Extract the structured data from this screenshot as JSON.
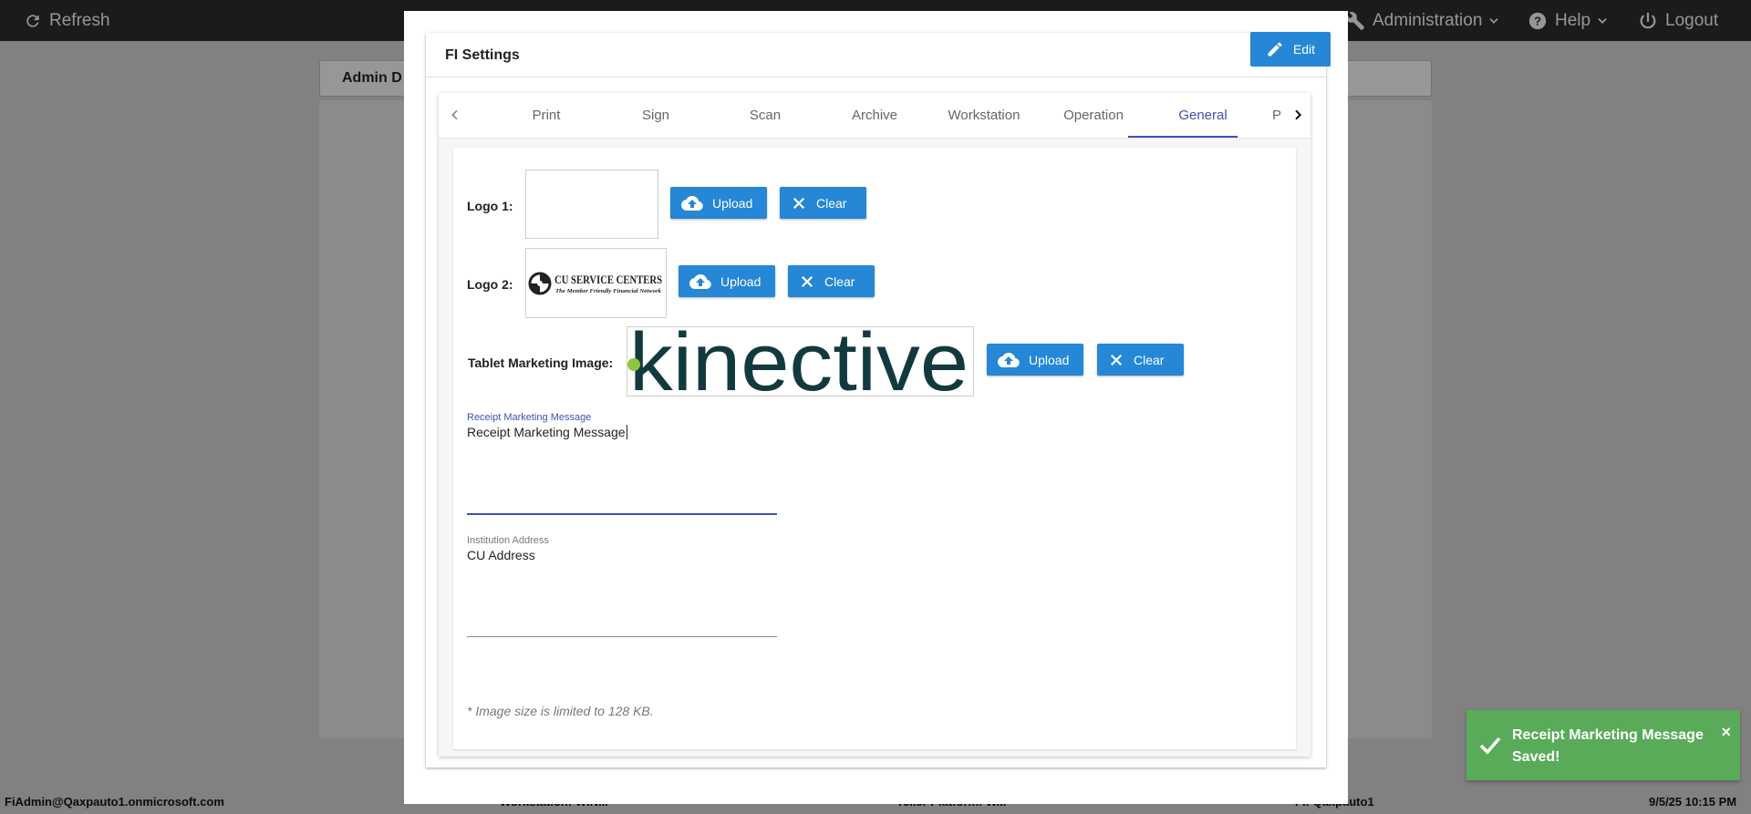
{
  "topbar": {
    "refresh_label": "Refresh",
    "administration_label": "Administration",
    "help_label": "Help",
    "logout_label": "Logout"
  },
  "background": {
    "admin_header": "Admin D"
  },
  "statusbar": {
    "user": "FiAdmin@Qaxpauto1.onmicrosoft.com",
    "workstation": "Workstation: WIN...",
    "platform": "Teller Platform: W...",
    "fi": "FI: Qaxpauto1",
    "datetime": "9/5/25 10:15 PM"
  },
  "modal": {
    "title": "FI Settings",
    "edit_label": "Edit",
    "tabs": [
      {
        "label": "Print"
      },
      {
        "label": "Sign"
      },
      {
        "label": "Scan"
      },
      {
        "label": "Archive"
      },
      {
        "label": "Workstation"
      },
      {
        "label": "Operation"
      },
      {
        "label": "General"
      },
      {
        "label": "P"
      }
    ],
    "active_tab": "General",
    "general": {
      "logo1_label": "Logo 1:",
      "logo2_label": "Logo 2:",
      "tablet_label": "Tablet Marketing Image:",
      "upload_label": "Upload",
      "clear_label": "Clear",
      "logo2_text_main": "CU SERVICE CENTERS",
      "logo2_text_sub": "The Member Friendly Financial Network",
      "tablet_image_text": "kinective",
      "receipt_field_label": "Receipt Marketing Message",
      "receipt_field_value": "Receipt Marketing Message",
      "address_field_label": "Institution Address",
      "address_field_value": "CU Address",
      "note": "* Image size is limited to 128 KB."
    }
  },
  "toast": {
    "message": "Receipt Marketing Message Saved!",
    "close_symbol": "×"
  },
  "colors": {
    "primary": "#2587d6",
    "tab_active": "#3f51b5",
    "toast": "#59ab59",
    "logo_teal": "#123a3e",
    "logo_green": "#8cc63f"
  }
}
